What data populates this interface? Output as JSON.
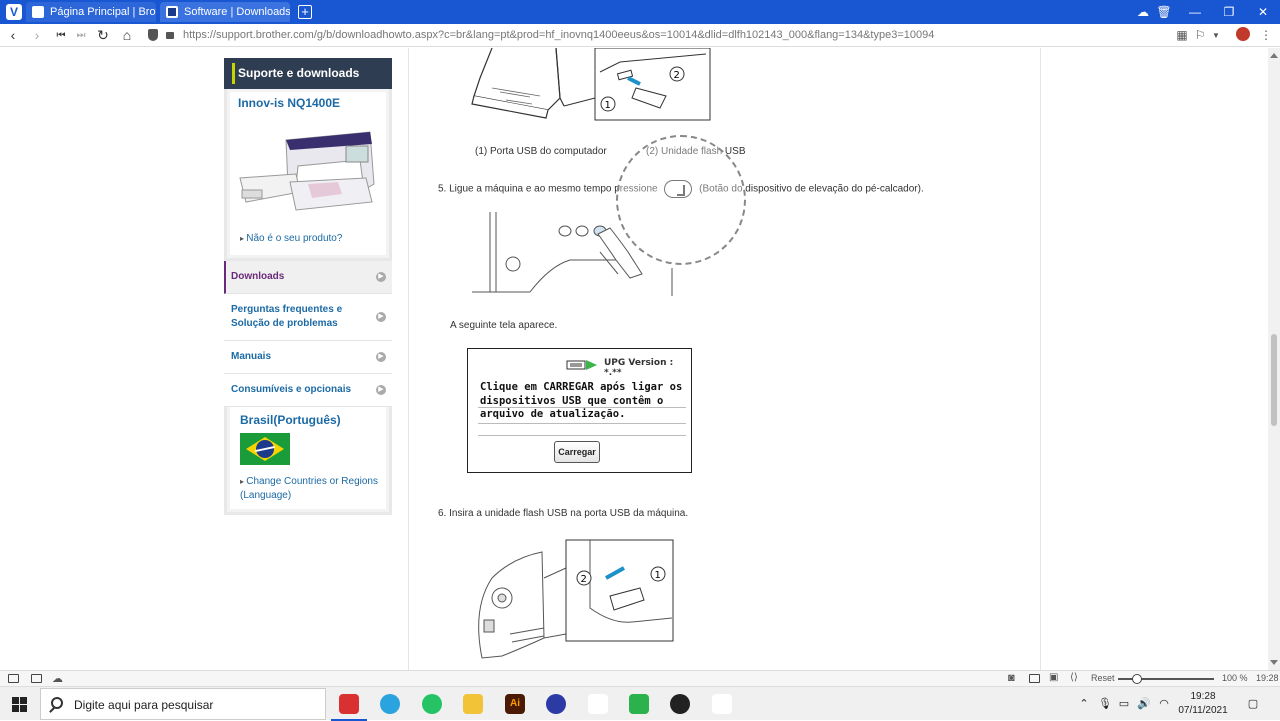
{
  "browser": {
    "tabs": [
      {
        "title": "Página Principal | Brother B",
        "active": false
      },
      {
        "title": "Software | Downloads | Inno",
        "active": true
      }
    ],
    "url": "https://support.brother.com/g/b/downloadhowto.aspx?c=br&lang=pt&prod=hf_inovnq1400eeus&os=10014&dlid=dlfh102143_000&flang=134&type3=10094"
  },
  "sidebar": {
    "header": "Suporte e downloads",
    "product_name": "Innov-is NQ1400E",
    "not_your_product": "Não é o seu produto?",
    "menu": [
      {
        "label": "Downloads",
        "active": true
      },
      {
        "label": "Perguntas frequentes e Solução de problemas",
        "active": false
      },
      {
        "label": "Manuais",
        "active": false
      },
      {
        "label": "Consumíveis e opcionais",
        "active": false
      }
    ],
    "region_title": "Brasil(Português)",
    "change_region": "Change Countries or Regions (Language)"
  },
  "content": {
    "caption_1": "(1)  Porta USB do computador",
    "caption_2": "(2) Unidade flash USB",
    "step5_prefix": "5. Ligue a máquina e ao mesmo tempo pressione",
    "step5_suffix": "(Botão do dispositivo de elevação do pé-calcador).",
    "screen_appears": "A seguinte tela aparece.",
    "upg_version": "UPG Version : *.**",
    "upg_message": "Clique em CARREGAR após ligar os\ndispositivos USB que contêm o\narquivo de atualização.",
    "upg_button": "Carregar",
    "step6": "6. Insira a unidade flash USB na porta USB da máquina.",
    "callout_1": "①",
    "callout_2": "②"
  },
  "statusbar": {
    "reset": "Reset",
    "zoom": "100 %",
    "time": "19:28"
  },
  "taskbar": {
    "search_placeholder": "Digite aqui para pesquisar",
    "clock_time": "19:28",
    "clock_date": "07/11/2021"
  },
  "colors": {
    "tabbar": "#1957d2",
    "sidebar_header": "#2f3d52",
    "link": "#1c6aa5",
    "active_menu": "#6a2a7a"
  }
}
